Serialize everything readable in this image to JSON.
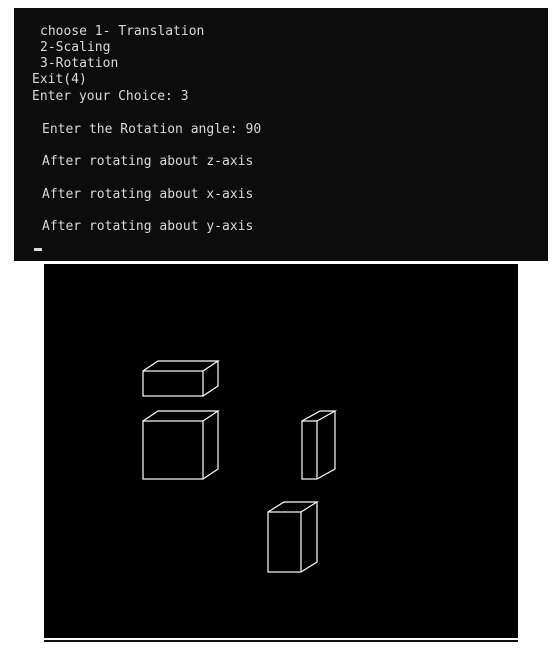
{
  "console": {
    "lines": [
      "choose 1- Translation",
      "2-Scaling",
      "3-Rotation",
      "Exit(4)",
      "Enter your Choice: 3",
      "Enter the Rotation angle: 90",
      "After rotating about z-axis",
      "After rotating about x-axis",
      "After rotating about y-axis"
    ]
  },
  "graphics": {
    "background": "#000000",
    "stroke": "#ffffff",
    "shapes": [
      "wide-flat-box",
      "cube",
      "tall-thin-box",
      "tall-box"
    ]
  }
}
